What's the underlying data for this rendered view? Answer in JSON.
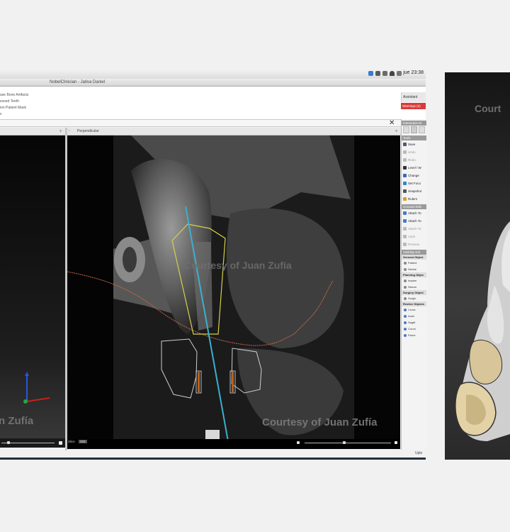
{
  "menubar": {
    "clock": "jue 23:38"
  },
  "window": {
    "title": "NobelClinician - Jativa Daniel"
  },
  "ribbon": {
    "items": [
      "ase Bone Artifacts",
      "essed Teeth",
      "ion Patient Mask",
      "s"
    ]
  },
  "assistant": {
    "label": "Assistant",
    "warnings": "Warnings (2)"
  },
  "views": {
    "perpendicular_label": "Perpendicular",
    "slice_label": "Slice",
    "slice_value": "203",
    "watermark": "Courtesy of Juan Zufía",
    "watermark_left": "n Zufía",
    "watermark_right": "Court"
  },
  "tools": {
    "interaction_header": "Interaction M",
    "tools_header": "Tools",
    "tool_items": [
      {
        "label": "Save",
        "dim": false
      },
      {
        "label": "Undo",
        "dim": true
      },
      {
        "label": "Redo",
        "dim": true
      },
      {
        "label": "Level / W",
        "dim": false
      },
      {
        "label": "Change",
        "dim": false
      },
      {
        "label": "Set Focu",
        "dim": false
      },
      {
        "label": "Snapshot",
        "dim": false
      },
      {
        "label": "Rulers",
        "dim": false
      }
    ],
    "crossed_header": "Crossed Edit",
    "crossed_items": [
      {
        "label": "Attach To",
        "dim": false
      },
      {
        "label": "Attach To",
        "dim": false
      },
      {
        "label": "Attach To",
        "dim": true
      },
      {
        "label": "Axial",
        "dim": true
      },
      {
        "label": "Preview",
        "dim": true
      }
    ],
    "visibility_header": "Visibility Edi",
    "groups": [
      {
        "title": "General Object",
        "items": [
          "Patient",
          "Dental"
        ]
      },
      {
        "title": "Planning Objec",
        "items": [
          "Implan",
          "Sleeve"
        ]
      },
      {
        "title": "Surgery Object",
        "items": [
          "Surgic"
        ]
      },
      {
        "title": "Reslice Objects",
        "items": [
          "Cross",
          "Axial",
          "Sagitt",
          "Coron",
          "Panor"
        ]
      }
    ],
    "upload": "Uplo"
  }
}
